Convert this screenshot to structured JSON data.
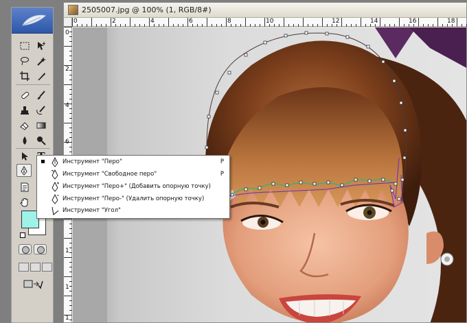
{
  "document": {
    "title": "2505007.jpg @ 100% (1, RGB/8#)"
  },
  "rulers": {
    "horizontal_marks": [
      "0",
      "2",
      "4",
      "6",
      "8",
      "10",
      "12",
      "14",
      "16",
      "18"
    ],
    "vertical_marks": [
      "0",
      "2",
      "4",
      "6",
      "8",
      "1",
      "1",
      "1",
      "1"
    ]
  },
  "toolbox": {
    "tools": [
      "feather-logo",
      "marquee",
      "move",
      "lasso",
      "magic-wand",
      "crop",
      "slice",
      "healing-brush",
      "brush",
      "stamp",
      "history-brush",
      "eraser",
      "gradient",
      "blur",
      "dodge",
      "path-selection",
      "type",
      "pen",
      "shape",
      "notes",
      "eyedropper",
      "hand",
      "zoom"
    ],
    "colors": {
      "foreground": "#9ef2e8",
      "background": "#ffffff"
    }
  },
  "pen_menu": {
    "items": [
      {
        "label": "Инструмент \"Перо\"",
        "shortcut": "P",
        "checked": true,
        "icon": "pen-icon"
      },
      {
        "label": "Инструмент \"Свободное перо\"",
        "shortcut": "P",
        "checked": false,
        "icon": "freeform-pen-icon"
      },
      {
        "label": "Инструмент \"Перо+\" (Добавить опорную точку)",
        "shortcut": "",
        "checked": false,
        "icon": "add-anchor-icon"
      },
      {
        "label": "Инструмент \"Перо-\" (Удалить опорную точку)",
        "shortcut": "",
        "checked": false,
        "icon": "delete-anchor-icon"
      },
      {
        "label": "Инструмент \"Угол\"",
        "shortcut": "",
        "checked": false,
        "icon": "convert-point-icon"
      }
    ]
  }
}
